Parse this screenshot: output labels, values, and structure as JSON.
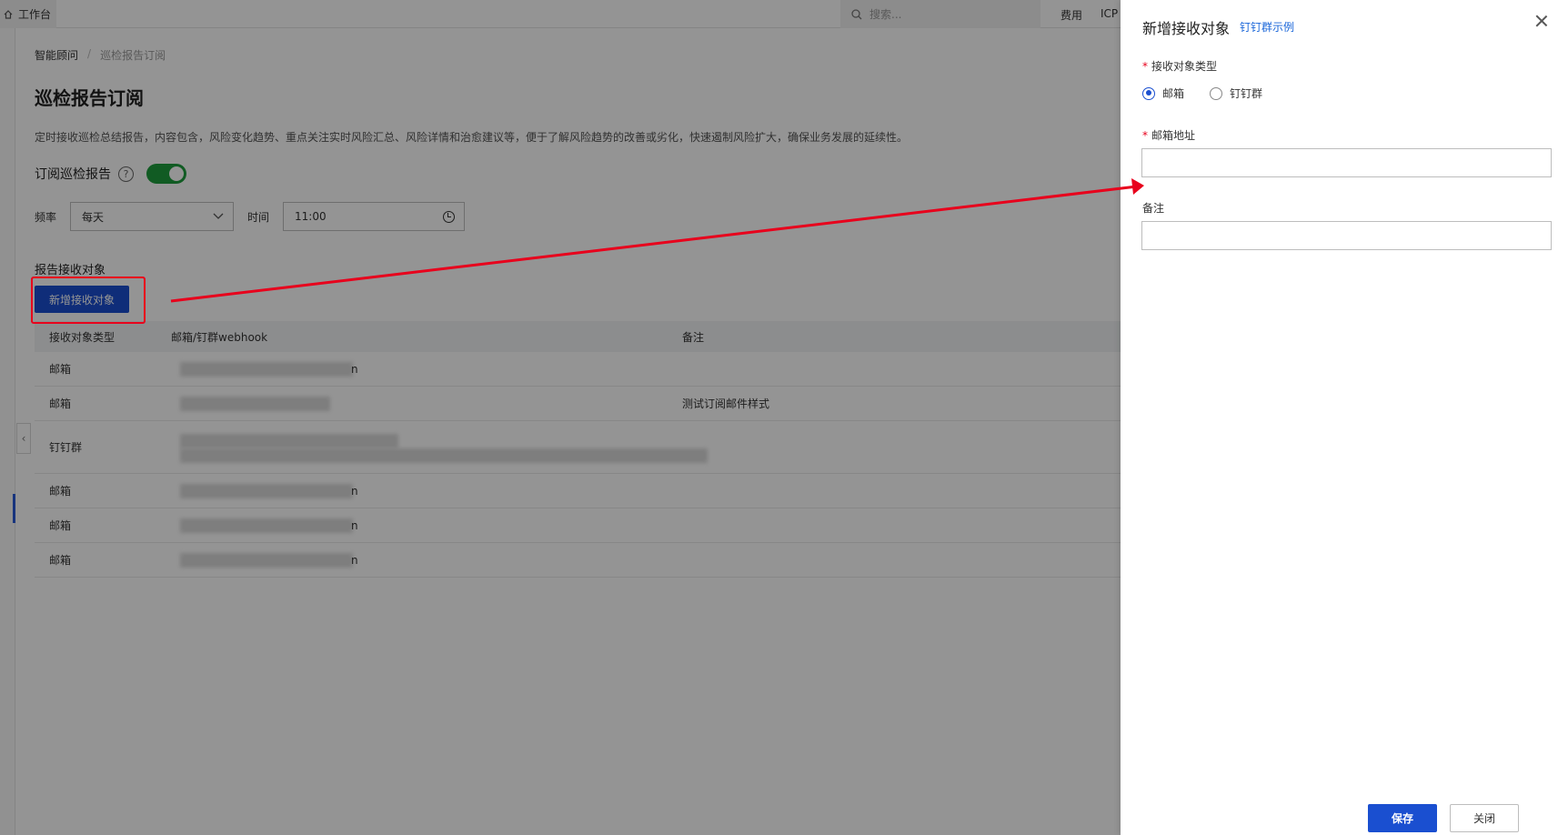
{
  "topbar": {
    "workbench": "工作台",
    "search_placeholder": "搜索...",
    "fee": "费用",
    "icp": "ICP"
  },
  "breadcrumb": {
    "parent": "智能顾问",
    "current": "巡检报告订阅"
  },
  "page": {
    "title": "巡检报告订阅",
    "description": "定时接收巡检总结报告，内容包含，风险变化趋势、重点关注实时风险汇总、风险详情和治愈建议等，便于了解风险趋势的改善或劣化，快速遏制风险扩大，确保业务发展的延续性。"
  },
  "subscribe": {
    "label": "订阅巡检报告",
    "help": "?",
    "enabled": true
  },
  "schedule": {
    "freq_label": "频率",
    "freq_value": "每天",
    "time_label": "时间",
    "time_value": "11:00"
  },
  "receivers": {
    "section_title": "报告接收对象",
    "add_button": "新增接收对象",
    "headers": [
      "接收对象类型",
      "邮箱/钉群webhook",
      "备注"
    ],
    "rows": [
      {
        "type": "邮箱",
        "note": "",
        "tail": "n"
      },
      {
        "type": "邮箱",
        "note": "测试订阅邮件样式",
        "tail": ""
      },
      {
        "type": "钉钉群",
        "note": "",
        "tail": ""
      },
      {
        "type": "邮箱",
        "note": "",
        "tail": "n"
      },
      {
        "type": "邮箱",
        "note": "",
        "tail": "n"
      },
      {
        "type": "邮箱",
        "note": "",
        "tail": "n"
      }
    ]
  },
  "drawer": {
    "title": "新增接收对象",
    "link": "钉钉群示例",
    "type_label": "接收对象类型",
    "options": [
      "邮箱",
      "钉钉群"
    ],
    "selected": "邮箱",
    "email_label": "邮箱地址",
    "email_value": "",
    "note_label": "备注",
    "note_value": "",
    "save": "保存",
    "close": "关闭"
  },
  "colors": {
    "primary": "#1a4fd0",
    "annotation": "#e8001c",
    "toggle_on": "#1e9e3d"
  }
}
